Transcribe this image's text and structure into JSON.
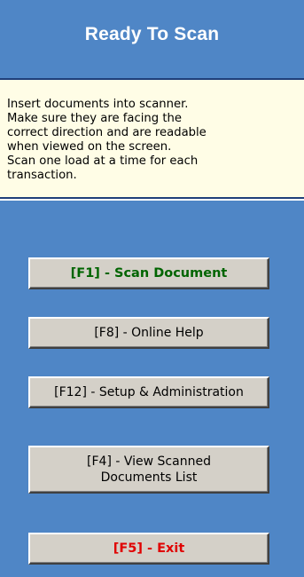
{
  "header": {
    "title": "Ready To Scan"
  },
  "instructions": {
    "text": "Insert documents into scanner.\nMake sure they are facing the\ncorrect direction and are readable\nwhen viewed on the screen.\nScan one load at a time for each\ntransaction."
  },
  "buttons": {
    "scan": "[F1] - Scan Document",
    "help": "[F8] - Online Help",
    "setup": "[F12] - Setup & Administration",
    "view": "[F4] - View Scanned\nDocuments List",
    "exit": "[F5] - Exit"
  },
  "colors": {
    "header_bg": "#4f86c6",
    "instructions_bg": "#fffde6",
    "button_bg": "#d4d0c8",
    "scan_text": "#006400",
    "exit_text": "#e00000"
  }
}
